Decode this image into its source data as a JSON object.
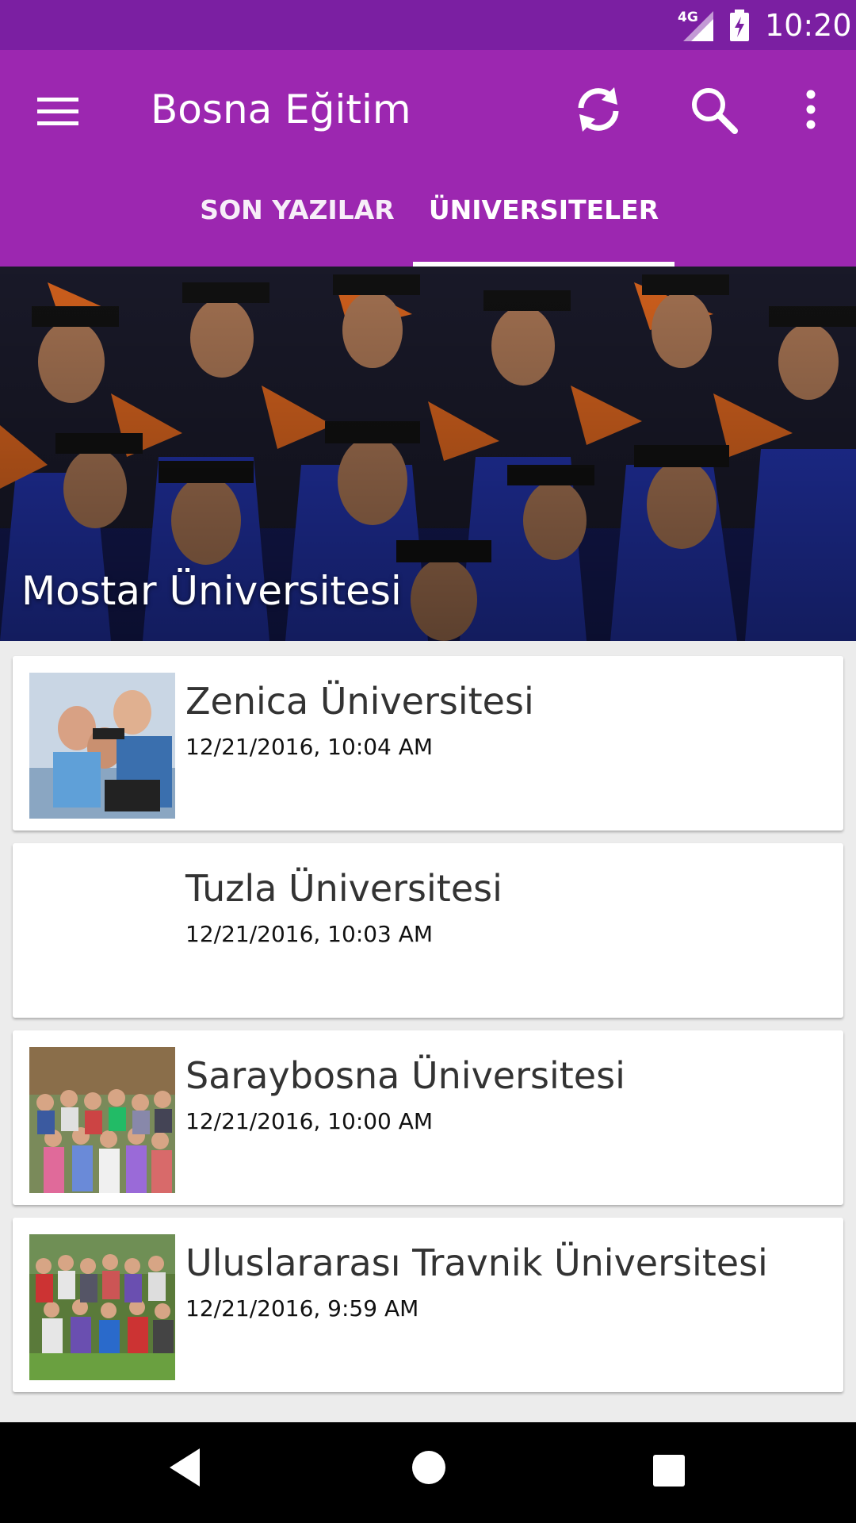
{
  "status_bar": {
    "network": "4G",
    "time": "10:20"
  },
  "app_bar": {
    "title": "Bosna Eğitim",
    "icons": {
      "menu": "menu-icon",
      "refresh": "refresh-icon",
      "search": "search-icon",
      "more": "more-vert-icon"
    }
  },
  "tabs": [
    {
      "label": "SON YAZILAR",
      "selected": false
    },
    {
      "label": "ÜNIVERSITELER",
      "selected": true
    }
  ],
  "featured": {
    "title": "Mostar Üniversitesi",
    "image": "graduates-photo"
  },
  "posts": [
    {
      "title": "Zenica Üniversitesi",
      "date": "12/21/2016, 10:04 AM",
      "thumbnail": "students-laptop-photo"
    },
    {
      "title": "Tuzla Üniversitesi",
      "date": "12/21/2016, 10:03 AM",
      "thumbnail": ""
    },
    {
      "title": "Saraybosna Üniversitesi",
      "date": "12/21/2016, 10:00 AM",
      "thumbnail": "group-photo"
    },
    {
      "title": "Uluslararası Travnik Üniversitesi",
      "date": "12/21/2016, 9:59 AM",
      "thumbnail": "group-lawn-photo"
    }
  ],
  "colors": {
    "status_bar": "#7b1fa2",
    "app_bar": "#9c27b0",
    "background": "#ececec",
    "nav_bar": "#000000"
  }
}
